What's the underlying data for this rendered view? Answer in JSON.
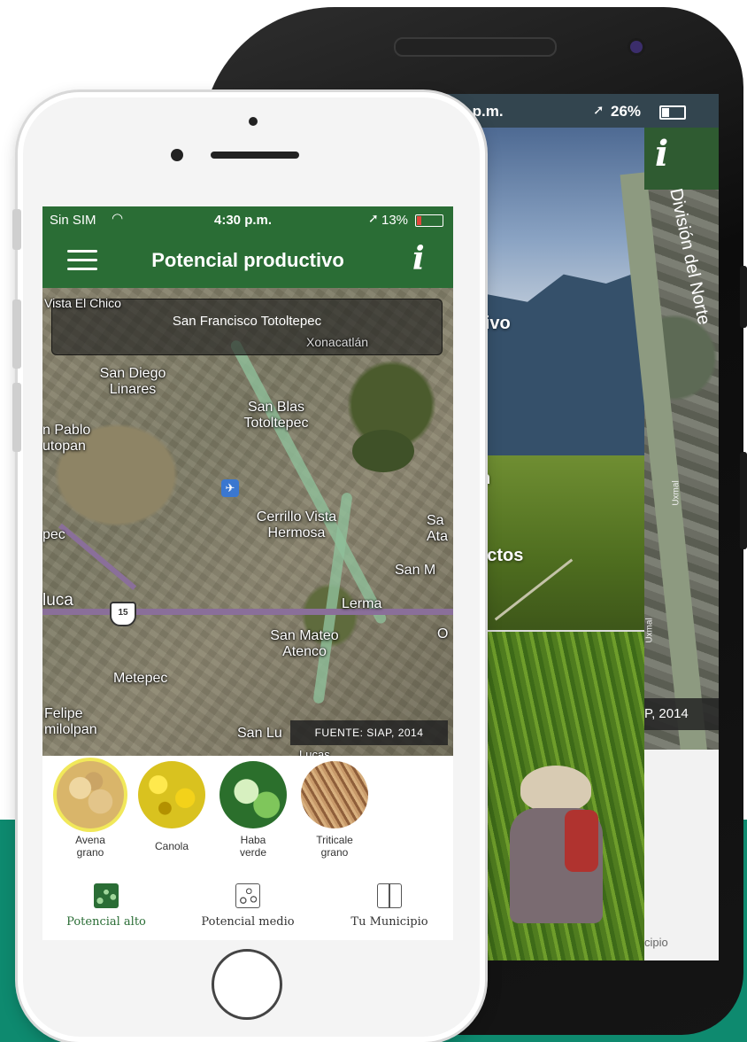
{
  "front": {
    "status": {
      "carrier": "Sin SIM",
      "time": "4:30 p.m.",
      "battery": "13%"
    },
    "appbar": {
      "title": "Potencial productivo"
    },
    "map": {
      "search_text": "San Francisco Totoltepec",
      "source": "FUENTE: SIAP, 2014",
      "route_shield": "15",
      "places": [
        "Vista El Chico",
        "Xonacatlán",
        "San Diego Linares",
        "San Blas Totoltepec",
        "n Pablo utopan",
        "Cerrillo Vista Hermosa",
        "San Mateo Atenco",
        "Lerma",
        "Metepec",
        "Felipe milolpan",
        "San Lu",
        "Lucas",
        "luca",
        "San M",
        "Sa Ata",
        "pec",
        "O"
      ]
    },
    "crops": [
      {
        "label": "Avena grano",
        "color": "#d9b56a"
      },
      {
        "label": "Canola",
        "color": "#d9c21f"
      },
      {
        "label": "Haba verde",
        "color": "#a8d88a"
      },
      {
        "label": "Triticale grano",
        "color": "#b5865a"
      }
    ],
    "tabs": [
      {
        "label": "Potencial alto"
      },
      {
        "label": "Potencial medio"
      },
      {
        "label": "Tu Municipio"
      }
    ],
    "colors": {
      "primary": "#2a6d35",
      "accent_band": "#0e8a6f"
    }
  },
  "back": {
    "status": {
      "time": "43 p.m.",
      "battery": "26%"
    },
    "menu": [
      "ctivo",
      "n",
      "uctos"
    ],
    "map_label": "División del Norte",
    "street_label": "Uxmal",
    "source": "P, 2014",
    "bottom_tab": "cipio"
  }
}
